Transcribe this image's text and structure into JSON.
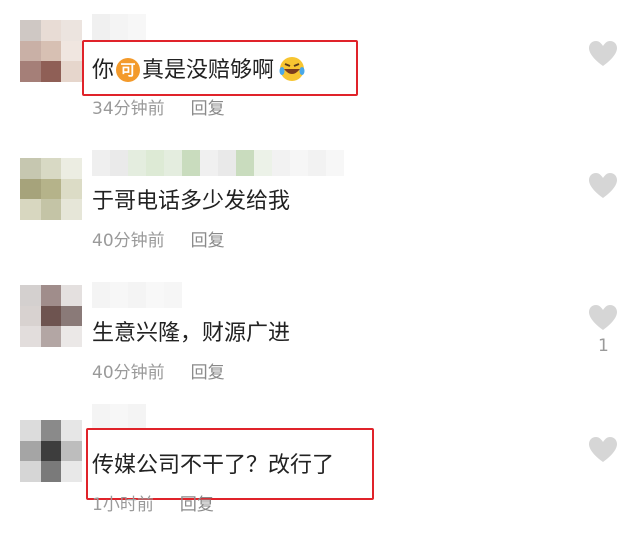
{
  "comments": [
    {
      "text_before": "你",
      "badge": "可",
      "text_after": "真是没赔够啊",
      "emoji": "rolling-laughing-emoji",
      "time": "34分钟前",
      "reply": "回复",
      "likes": ""
    },
    {
      "text": "于哥电话多少发给我",
      "time": "40分钟前",
      "reply": "回复",
      "likes": ""
    },
    {
      "text": "生意兴隆，财源广进",
      "time": "40分钟前",
      "reply": "回复",
      "likes": "1"
    },
    {
      "text": "传媒公司不干了？改行了",
      "time": "1小时前",
      "reply": "回复",
      "likes": ""
    }
  ],
  "colors": {
    "highlight": "#e0232a",
    "badge": "#f39a2b",
    "heart": "#d6d6d6"
  }
}
